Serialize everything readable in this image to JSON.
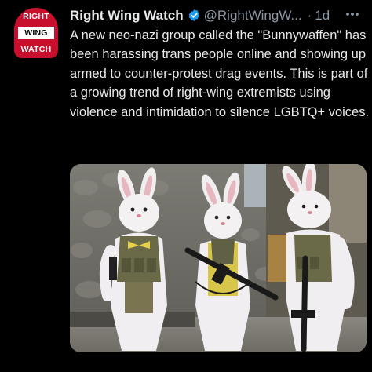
{
  "avatar": {
    "logo_lines": [
      "RIGHT",
      "WING",
      "WATCH"
    ],
    "color": "#c8102e"
  },
  "tweet": {
    "author_name": "Right Wing Watch",
    "handle": "@RightWingW...",
    "separator": "·",
    "time": "1d",
    "text": "A new neo-nazi group called the \"Bunnywaffen\" has been harassing trans people online and showing up armed to counter-protest drag events. This is part of a growing trend of right-wing extremists using violence and intimidation to silence LGBTQ+ voices."
  },
  "icons": {
    "verified": "verified-badge-icon",
    "more": "more-options-icon"
  },
  "colors": {
    "background": "#000000",
    "text": "#e7e9ea",
    "secondary": "#8b98a5",
    "verified": "#1d9bf0"
  }
}
